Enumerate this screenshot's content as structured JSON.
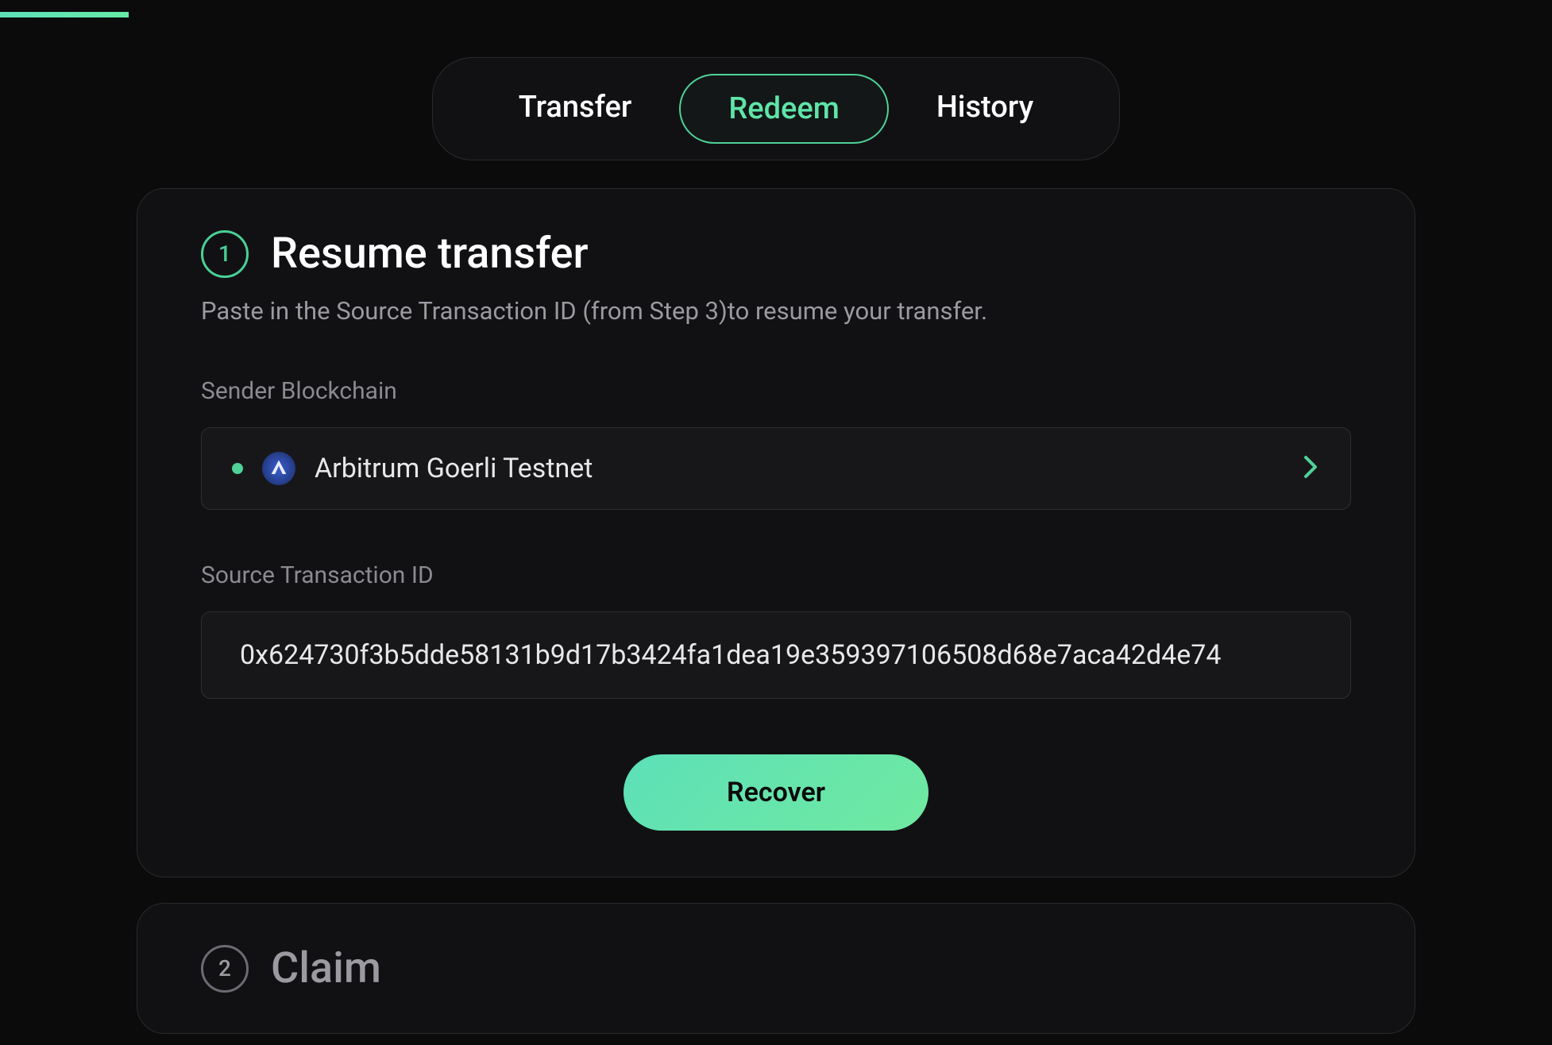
{
  "tabs": {
    "transfer": "Transfer",
    "redeem": "Redeem",
    "history": "History",
    "active": "redeem"
  },
  "step1": {
    "number": "1",
    "title": "Resume transfer",
    "subtitle": "Paste in the Source Transaction ID (from Step 3)to resume your transfer.",
    "sender_label": "Sender Blockchain",
    "chain_name": "Arbitrum Goerli Testnet",
    "tx_label": "Source Transaction ID",
    "tx_value": "0x624730f3b5dde58131b9d17b3424fa1dea19e359397106508d68e7aca42d4e74",
    "recover_label": "Recover"
  },
  "step2": {
    "number": "2",
    "title": "Claim"
  }
}
